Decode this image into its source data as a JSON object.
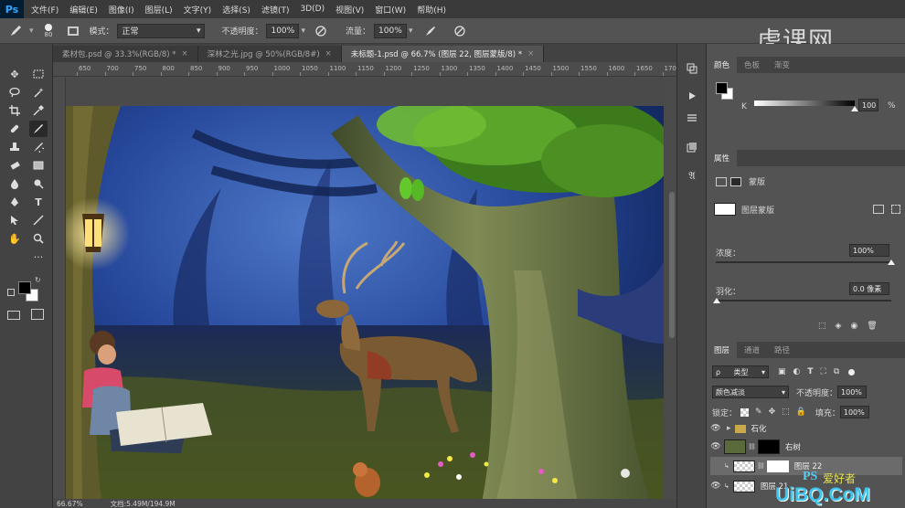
{
  "app": {
    "logo": "Ps"
  },
  "menu": [
    "文件(F)",
    "编辑(E)",
    "图像(I)",
    "图层(L)",
    "文字(Y)",
    "选择(S)",
    "滤镜(T)",
    "3D(D)",
    "视图(V)",
    "窗口(W)",
    "帮助(H)"
  ],
  "options": {
    "brush_size": "80",
    "mode_label": "模式：",
    "mode_value": "正常",
    "opacity_label": "不透明度：",
    "opacity_value": "100%",
    "flow_label": "流量：",
    "flow_value": "100%"
  },
  "tabs": [
    {
      "label": "素材包.psd @ 33.3%(RGB/8) *",
      "active": false
    },
    {
      "label": "深林之光.jpg @ 50%(RGB/8#)",
      "active": false
    },
    {
      "label": "未标题-1.psd @ 66.7% (图层 22, 图层蒙版/8) *",
      "active": true
    }
  ],
  "ruler": {
    "top_numbers": [
      "650",
      "700",
      "750",
      "800",
      "850",
      "900",
      "950",
      "1000",
      "1050",
      "1100",
      "1150",
      "1200",
      "1250",
      "1300",
      "1350",
      "1400",
      "1450",
      "1500",
      "1550",
      "1600",
      "1650",
      "1700"
    ]
  },
  "status": {
    "zoom": "66.67%",
    "doc": "文档:5.49M/194.9M"
  },
  "panels": {
    "color": {
      "tabs": [
        "颜色",
        "色板",
        "渐变"
      ],
      "channel": "K",
      "value": "100",
      "unit": "%"
    },
    "properties": {
      "tab": "属性",
      "kind": "蒙版",
      "mask_label": "图层蒙版",
      "density_label": "浓度：",
      "density_value": "100%",
      "feather_label": "羽化：",
      "feather_value": "0.0 像素"
    },
    "layers": {
      "tabs": [
        "图层",
        "通道",
        "路径"
      ],
      "filter": "类型",
      "blend_mode": "颜色减淡",
      "opacity_label": "不透明度：",
      "opacity_value": "100%",
      "lock_label": "锁定：",
      "fill_label": "填充：",
      "fill_value": "100%",
      "items": [
        {
          "name": "石化",
          "selected": false
        },
        {
          "name": "右树",
          "selected": false
        },
        {
          "name": "图层 22",
          "selected": true
        },
        {
          "name": "图层 21",
          "selected": false
        }
      ]
    }
  },
  "watermark": {
    "top": "虎课网",
    "ps_tag": "PS",
    "ps_tag2": "爱好者",
    "bottom": "UiBQ.CoM"
  },
  "colors": {
    "fg": "#000000",
    "bg": "#ffffff",
    "accent": "#31a8ff"
  }
}
